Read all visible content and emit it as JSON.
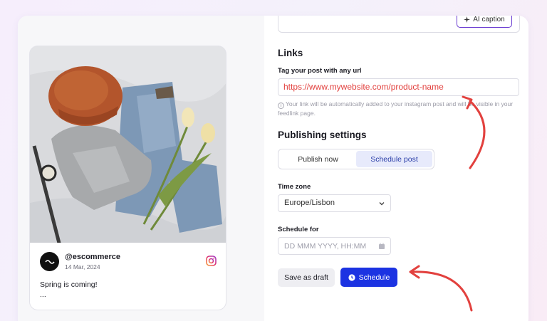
{
  "caption_box": {
    "ai_caption_label": "AI caption"
  },
  "post_preview": {
    "account_name": "@escommerce",
    "date": "14 Mar, 2024",
    "caption": "Spring is coming!",
    "caption_more": "...",
    "image_icon": "flatlay-photo",
    "platform_icon": "instagram-icon"
  },
  "links": {
    "title": "Links",
    "field_label": "Tag your post with any url",
    "url_value": "https://www.mywebsite.com/product-name",
    "help_text": "Your link will be automatically added to your instagram post and will be visible in your feedlink page."
  },
  "publishing": {
    "title": "Publishing settings",
    "options": [
      "Publish now",
      "Schedule post"
    ],
    "selected": "Schedule post"
  },
  "timezone": {
    "label": "Time zone",
    "value": "Europe/Lisbon"
  },
  "schedule_for": {
    "label": "Schedule for",
    "placeholder": "DD MMM YYYY, HH:MM"
  },
  "actions": {
    "draft_label": "Save as draft",
    "schedule_label": "Schedule"
  },
  "colors": {
    "accent": "#1c33e2",
    "annotation_red": "#e2413e",
    "ai_border": "#6a3bd1",
    "segment_active": "#e7eafb"
  }
}
